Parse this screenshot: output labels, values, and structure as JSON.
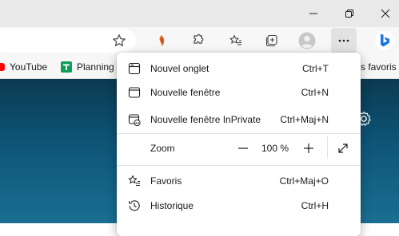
{
  "window": {
    "controls": [
      "minimize-icon",
      "restore-icon",
      "close-icon"
    ]
  },
  "toolbar": {
    "icons": [
      "star-icon",
      "extension-puzzle-icon",
      "extensions-icon",
      "favorites-icon",
      "collections-icon",
      "profile-icon",
      "more-options-icon",
      "bing-icon"
    ]
  },
  "favorites_bar": {
    "items": [
      {
        "label": "YouTube",
        "icon": "youtube-icon",
        "color": "#ff0000"
      },
      {
        "label": "Planning",
        "icon": "sheets-icon",
        "color": "#0f9d58"
      }
    ],
    "other_label": "s favoris"
  },
  "menu": {
    "items": [
      {
        "label": "Nouvel onglet",
        "shortcut": "Ctrl+T",
        "icon": "new-tab-icon"
      },
      {
        "label": "Nouvelle fenêtre",
        "shortcut": "Ctrl+N",
        "icon": "new-window-icon"
      },
      {
        "label": "Nouvelle fenêtre InPrivate",
        "shortcut": "Ctrl+Maj+N",
        "icon": "inprivate-window-icon"
      }
    ],
    "zoom": {
      "label": "Zoom",
      "value": "100 %",
      "minus": "−",
      "plus": "+"
    },
    "items2": [
      {
        "label": "Favoris",
        "shortcut": "Ctrl+Maj+O",
        "icon": "favorites-icon"
      },
      {
        "label": "Historique",
        "shortcut": "Ctrl+H",
        "icon": "history-icon"
      }
    ]
  },
  "colors": {
    "accent_bing": "#1a73e8",
    "content_bg": "#0e5577"
  }
}
